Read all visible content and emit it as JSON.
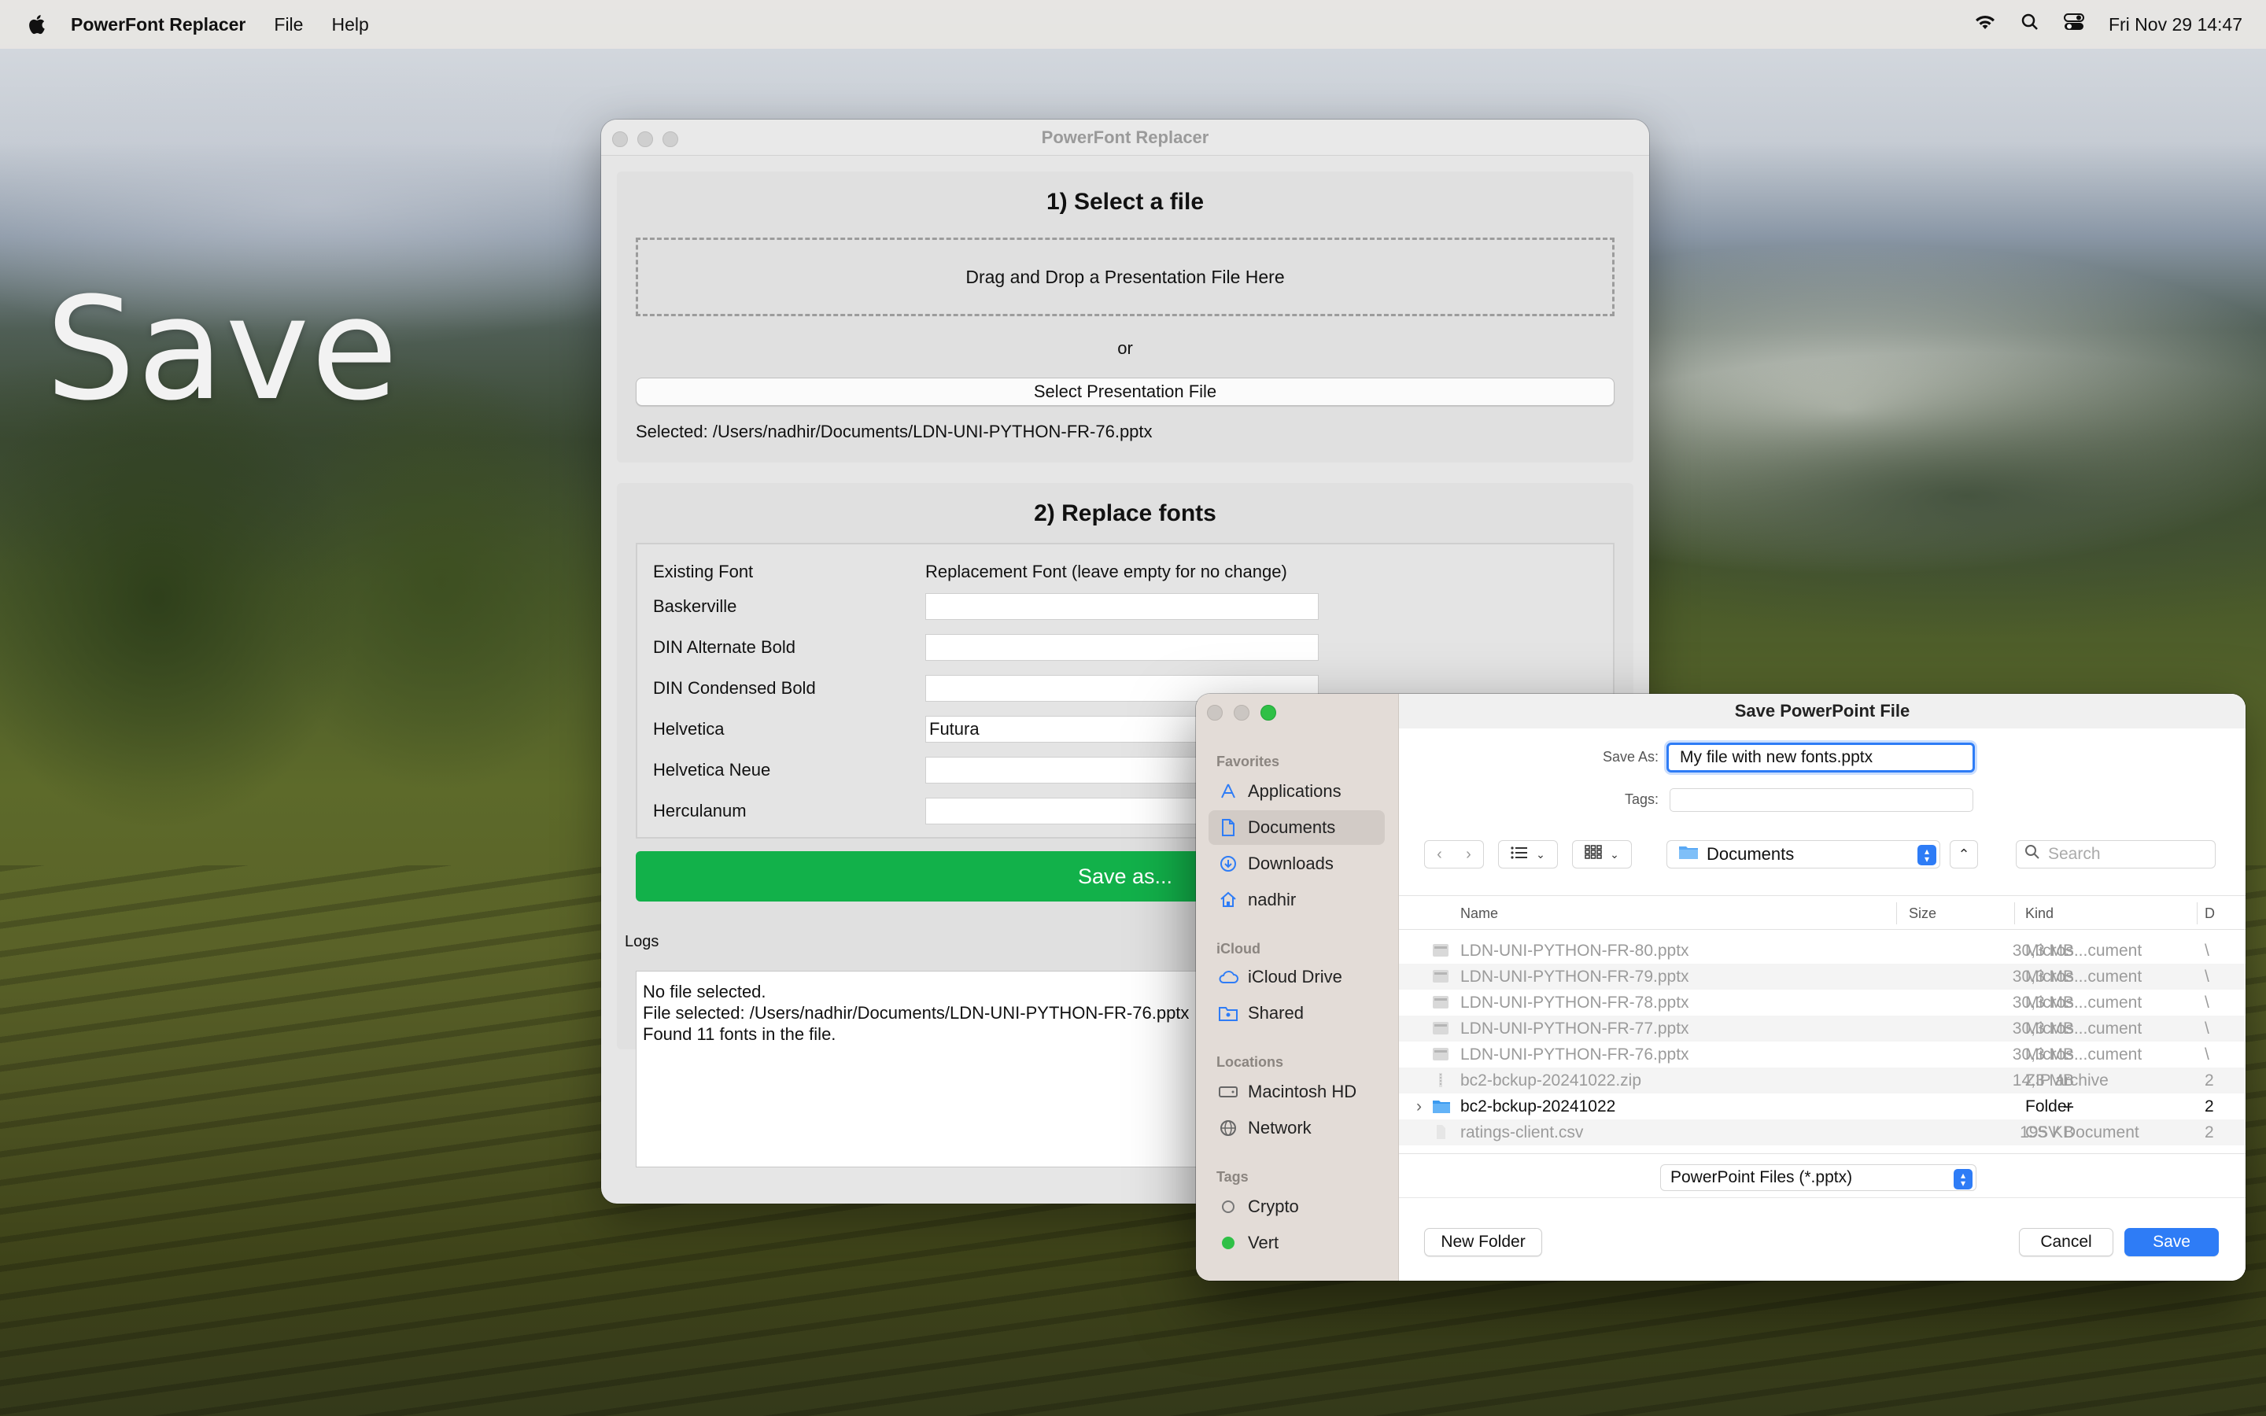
{
  "menubar": {
    "app_name": "PowerFont Replacer",
    "menus": [
      "File",
      "Help"
    ],
    "clock": "Fri Nov 29  14:47",
    "icons": [
      "apple-icon",
      "wifi-icon",
      "search-icon",
      "control-center-icon"
    ]
  },
  "desktop": {
    "overlay_text": "Save"
  },
  "main_window": {
    "title": "PowerFont Replacer",
    "section1": {
      "heading": "1) Select a file",
      "dropzone": "Drag and Drop a Presentation File Here",
      "or": "or",
      "select_button": "Select Presentation File",
      "selected": "Selected: /Users/nadhir/Documents/LDN-UNI-PYTHON-FR-76.pptx"
    },
    "section2": {
      "heading": "2) Replace fonts",
      "col_existing": "Existing Font",
      "col_replacement": "Replacement Font (leave empty for no change)",
      "fonts": [
        {
          "name": "Baskerville",
          "replacement": ""
        },
        {
          "name": "DIN Alternate Bold",
          "replacement": ""
        },
        {
          "name": "DIN Condensed Bold",
          "replacement": ""
        },
        {
          "name": "Helvetica",
          "replacement": "Futura"
        },
        {
          "name": "Helvetica Neue",
          "replacement": ""
        },
        {
          "name": "Herculanum",
          "replacement": ""
        }
      ],
      "save_button": "Save as..."
    },
    "logs": {
      "label": "Logs",
      "lines": [
        "No file selected.",
        "File selected: /Users/nadhir/Documents/LDN-UNI-PYTHON-FR-76.pptx",
        "Found 11 fonts in the file."
      ]
    }
  },
  "save_dialog": {
    "title": "Save PowerPoint File",
    "save_as_label": "Save As:",
    "save_as_value": "My file with new fonts.pptx",
    "tags_label": "Tags:",
    "location": "Documents",
    "search_placeholder": "Search",
    "sidebar": {
      "favorites_label": "Favorites",
      "favorites": [
        "Applications",
        "Documents",
        "Downloads",
        "nadhir"
      ],
      "icloud_label": "iCloud",
      "icloud": [
        "iCloud Drive",
        "Shared"
      ],
      "locations_label": "Locations",
      "locations": [
        "Macintosh HD",
        "Network"
      ],
      "tags_label": "Tags",
      "tags": [
        "Crypto",
        "Vert"
      ]
    },
    "columns": {
      "name": "Name",
      "size": "Size",
      "kind": "Kind",
      "date": "D"
    },
    "files": [
      {
        "name": "LDN-UNI-PYTHON-FR-80.pptx",
        "size": "30,3 MB",
        "kind": "Micros...cument",
        "extra": "\\"
      },
      {
        "name": "LDN-UNI-PYTHON-FR-79.pptx",
        "size": "30,3 MB",
        "kind": "Micros...cument",
        "extra": "\\"
      },
      {
        "name": "LDN-UNI-PYTHON-FR-78.pptx",
        "size": "30,3 MB",
        "kind": "Micros...cument",
        "extra": "\\"
      },
      {
        "name": "LDN-UNI-PYTHON-FR-77.pptx",
        "size": "30,3 MB",
        "kind": "Micros...cument",
        "extra": "\\"
      },
      {
        "name": "LDN-UNI-PYTHON-FR-76.pptx",
        "size": "30,3 MB",
        "kind": "Micros...cument",
        "extra": "\\"
      },
      {
        "name": "bc2-bckup-20241022.zip",
        "size": "14,3 MB",
        "kind": "ZIP archive",
        "extra": "2"
      },
      {
        "name": "bc2-bckup-20241022",
        "size": "--",
        "kind": "Folder",
        "extra": "2"
      },
      {
        "name": "ratings-client.csv",
        "size": "195 KB",
        "kind": "CSV Document",
        "extra": "2"
      }
    ],
    "file_type": "PowerPoint Files (*.pptx)",
    "new_folder": "New Folder",
    "cancel": "Cancel",
    "save": "Save",
    "colors": {
      "accent": "#2e7cf6",
      "save_as_green": "#12b14a",
      "tag_vert": "#2fc046"
    }
  }
}
